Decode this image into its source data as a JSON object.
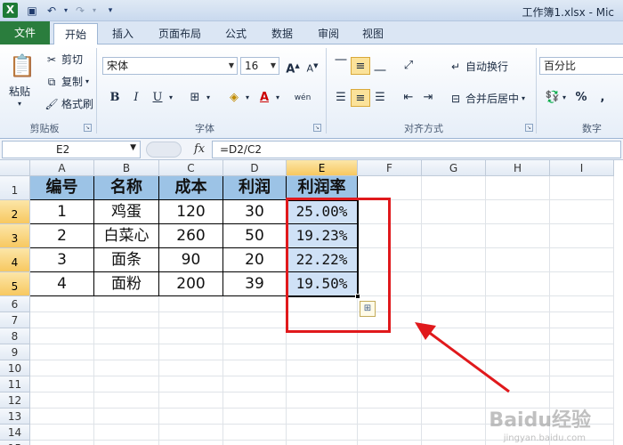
{
  "window": {
    "title": "工作簿1.xlsx - Mic"
  },
  "quick_access": {
    "save_icon": "floppy-icon",
    "undo_icon": "undo-icon",
    "redo_icon": "redo-icon"
  },
  "tabs": [
    {
      "label": "文件"
    },
    {
      "label": "开始"
    },
    {
      "label": "插入"
    },
    {
      "label": "页面布局"
    },
    {
      "label": "公式"
    },
    {
      "label": "数据"
    },
    {
      "label": "审阅"
    },
    {
      "label": "视图"
    }
  ],
  "ribbon": {
    "clipboard": {
      "paste": "粘贴",
      "cut": "剪切",
      "copy": "复制",
      "format_painter": "格式刷",
      "label": "剪贴板"
    },
    "font": {
      "name": "宋体",
      "size": "16",
      "bold": "B",
      "italic": "I",
      "underline": "U",
      "label": "字体",
      "grow": "A",
      "shrink": "A",
      "wen": "wén"
    },
    "alignment": {
      "wrap": "自动换行",
      "merge": "合并后居中",
      "label": "对齐方式"
    },
    "number": {
      "format": "百分比",
      "percent": "%",
      "comma": ",",
      "label": "数字"
    }
  },
  "formula_bar": {
    "name_box": "E2",
    "fx": "fx",
    "formula": "=D2/C2"
  },
  "columns": [
    "A",
    "B",
    "C",
    "D",
    "E",
    "F",
    "G",
    "H",
    "I"
  ],
  "rows": [
    "1",
    "2",
    "3",
    "4",
    "5",
    "6",
    "7",
    "8",
    "9",
    "10",
    "11",
    "12",
    "13",
    "14",
    "15"
  ],
  "table": {
    "headers": [
      "编号",
      "名称",
      "成本",
      "利润",
      "利润率"
    ],
    "rows": [
      [
        "1",
        "鸡蛋",
        "120",
        "30",
        "25.00%"
      ],
      [
        "2",
        "白菜心",
        "260",
        "50",
        "19.23%"
      ],
      [
        "3",
        "面条",
        "90",
        "20",
        "22.22%"
      ],
      [
        "4",
        "面粉",
        "200",
        "39",
        "19.50%"
      ]
    ]
  },
  "colors": {
    "header_fill": "#9cc3e6",
    "selection_fill": "#cfe1f6",
    "annotation": "#e0191c"
  },
  "watermark": {
    "text": "Baidu经验",
    "sub": "jingyan.baidu.com"
  }
}
